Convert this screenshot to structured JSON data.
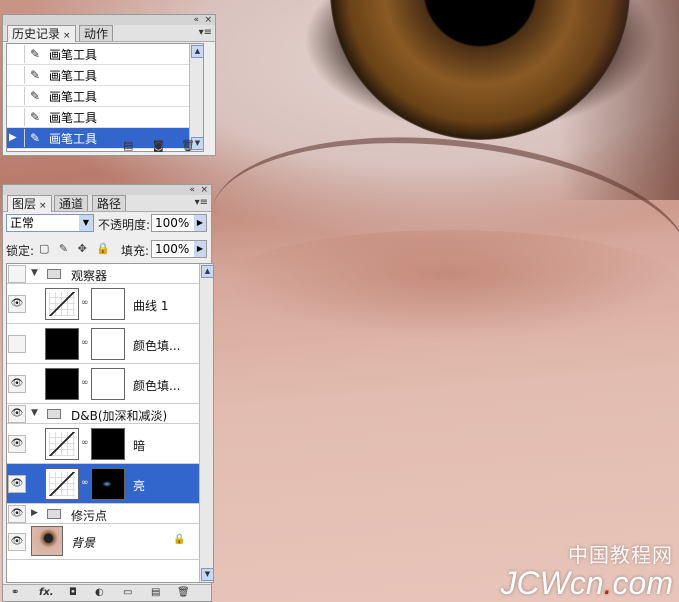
{
  "history_panel": {
    "tabs": [
      {
        "label": "历史记录",
        "active": true,
        "close": "×"
      },
      {
        "label": "动作",
        "active": false
      }
    ],
    "window_controls": "«",
    "window_close": "×",
    "menu": "▾≡",
    "items": [
      {
        "label": "画笔工具",
        "selected": false
      },
      {
        "label": "画笔工具",
        "selected": false
      },
      {
        "label": "画笔工具",
        "selected": false
      },
      {
        "label": "画笔工具",
        "selected": false
      },
      {
        "label": "画笔工具",
        "selected": true
      }
    ]
  },
  "layers_panel": {
    "tabs": [
      {
        "label": "图层",
        "active": true,
        "close": "×"
      },
      {
        "label": "通道",
        "active": false
      },
      {
        "label": "路径",
        "active": false
      }
    ],
    "window_controls": "«",
    "window_close": "×",
    "menu": "▾≡",
    "blend_mode": "正常",
    "opacity_label": "不透明度:",
    "opacity_value": "100%",
    "lock_label": "锁定:",
    "fill_label": "填充:",
    "fill_value": "100%",
    "layers": [
      {
        "name": "观察器",
        "kind": "group",
        "visible": false
      },
      {
        "name": "曲线 1",
        "kind": "curves",
        "visible": true
      },
      {
        "name": "颜色填...",
        "kind": "fill",
        "visible": false
      },
      {
        "name": "颜色填...",
        "kind": "fill",
        "visible": true
      },
      {
        "name": "D&B(加深和减淡)",
        "kind": "group",
        "visible": true
      },
      {
        "name": "暗",
        "kind": "curves",
        "visible": true
      },
      {
        "name": "亮",
        "kind": "curves",
        "visible": true,
        "selected": true
      },
      {
        "name": "修污点",
        "kind": "group",
        "visible": true
      },
      {
        "name": "背景",
        "kind": "background",
        "visible": true,
        "locked": true
      }
    ],
    "footer_fx": "fx."
  },
  "watermark": {
    "cn": "中国教程网",
    "en_left": "JCWcn",
    "en_dot": ".",
    "en_right": "com"
  },
  "colors": {
    "selection": "#3366cc",
    "panel_bg": "#eeeeee",
    "watermark_dot": "#e01010"
  }
}
